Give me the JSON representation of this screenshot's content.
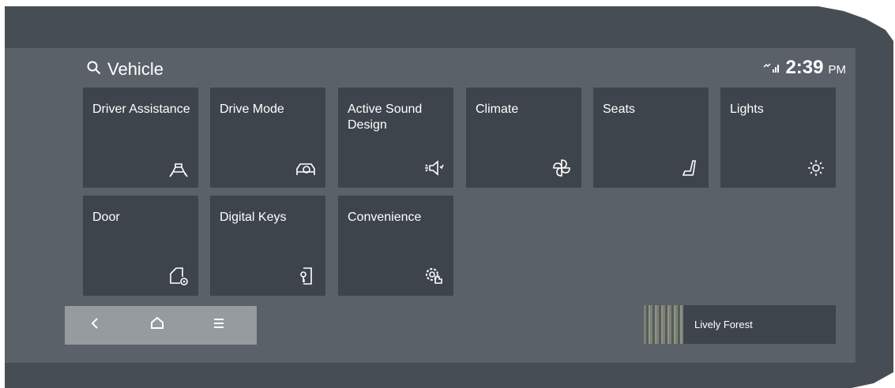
{
  "header": {
    "title": "Vehicle",
    "time": "2:39",
    "ampm": "PM"
  },
  "tiles": [
    {
      "label": "Driver Assistance",
      "icon": "driver-assistance-icon"
    },
    {
      "label": "Drive Mode",
      "icon": "drive-mode-icon"
    },
    {
      "label": "Active Sound Design",
      "icon": "active-sound-icon"
    },
    {
      "label": "Climate",
      "icon": "fan-icon"
    },
    {
      "label": "Seats",
      "icon": "seat-icon"
    },
    {
      "label": "Lights",
      "icon": "light-icon"
    },
    {
      "label": "Door",
      "icon": "door-settings-icon"
    },
    {
      "label": "Digital Keys",
      "icon": "digital-key-icon"
    },
    {
      "label": "Convenience",
      "icon": "convenience-gear-icon"
    }
  ],
  "nav": {
    "back_icon": "back-chevron-icon",
    "home_icon": "home-icon",
    "menu_icon": "menu-icon"
  },
  "media": {
    "title": "Lively Forest"
  }
}
